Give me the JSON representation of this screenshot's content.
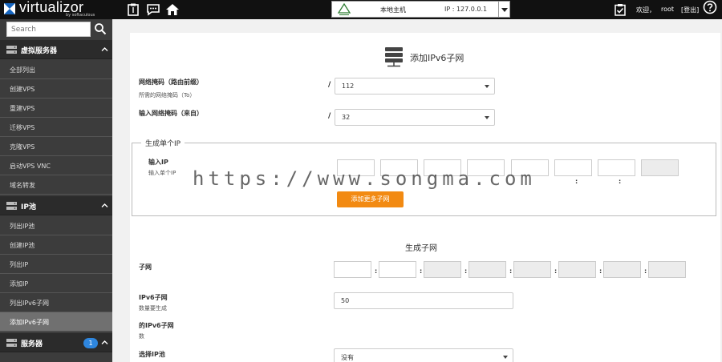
{
  "brand": {
    "name": "virtualizor",
    "sub": "by softaculous"
  },
  "header": {
    "host_name": "本地主机",
    "host_ip": "IP : 127.0.0.1",
    "welcome": "欢迎，",
    "user": "root",
    "logout": "[登出]"
  },
  "sidebar": {
    "search_placeholder": "Search",
    "sections": [
      {
        "label": "虚拟服务器",
        "items": [
          "全部列出",
          "创建VPS",
          "重建VPS",
          "迁移VPS",
          "克隆VPS",
          "启动VPS VNC",
          "域名转发"
        ]
      },
      {
        "label": "IP池",
        "items": [
          "列出IP池",
          "创建IP池",
          "列出IP",
          "添加IP",
          "列出IPv6子网",
          "添加IPv6子网"
        ]
      },
      {
        "label": "服务器",
        "badge": "1",
        "items": []
      }
    ],
    "active_item": "添加IPv6子网"
  },
  "main": {
    "title": "添加IPv6子网",
    "netmask_label": "网络掩码（路由前缀）",
    "netmask_hint": "所需的网络掩码（To）",
    "netmask_value": "112",
    "input_netmask_label": "输入网络掩码（来自）",
    "input_netmask_value": "32",
    "single_legend": "生成单个IP",
    "input_ip_label": "输入IP",
    "input_ip_hint": "输入单个IP",
    "add_more_button": "添加更多子网",
    "generate_title": "生成子网",
    "subnet_label": "子网",
    "ipv6_subnet_label": "IPv6子网",
    "ipv6_subnet_hint": "数量要生成",
    "ipv6_subnet_value": "50",
    "of_ipv6_label": "的IPv6子网",
    "of_ipv6_hint": "数",
    "choose_pool_label": "选择IP池",
    "choose_pool_value": "没有"
  },
  "watermark": "https://www.songma.com",
  "colors": {
    "topbar": "#111111",
    "sidebar": "#3c3c3c",
    "accent_button": "#f28a12",
    "badge": "#2e86de"
  },
  "icons": [
    "logo-icon",
    "clipboard-icon",
    "chat-icon",
    "home-icon",
    "tasks-icon",
    "help-icon",
    "search-icon",
    "server-icon",
    "chevron-up-icon"
  ]
}
